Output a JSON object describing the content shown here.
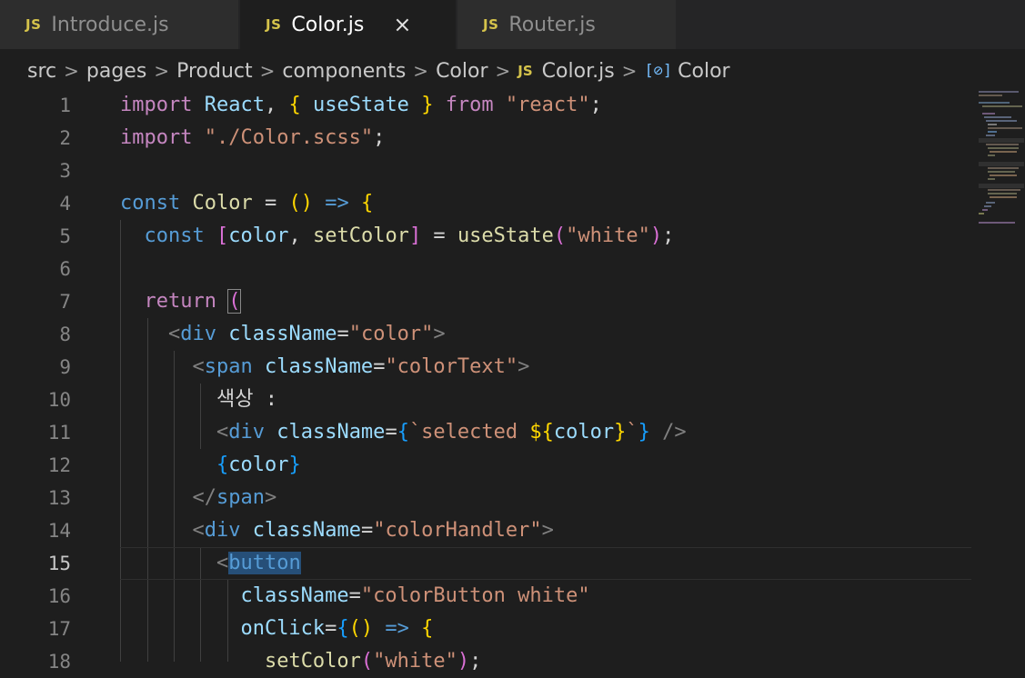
{
  "tabs": [
    {
      "icon": "JS",
      "label": "Introduce.js",
      "active": false
    },
    {
      "icon": "JS",
      "label": "Color.js",
      "active": true,
      "close": "×"
    },
    {
      "icon": "JS",
      "label": "Router.js",
      "active": false
    }
  ],
  "breadcrumb": {
    "items": [
      "src",
      "pages",
      "Product",
      "components",
      "Color"
    ],
    "file_icon": "JS",
    "file": "Color.js",
    "symbol_icon": "[⊘]",
    "symbol": "Color",
    "separator": ">"
  },
  "editor": {
    "current_line": 15,
    "line_numbers": [
      "1",
      "2",
      "3",
      "4",
      "5",
      "6",
      "7",
      "8",
      "9",
      "10",
      "11",
      "12",
      "13",
      "14",
      "15",
      "16",
      "17",
      "18"
    ],
    "tokens": {
      "import": "import",
      "from": "from",
      "react_name": "React",
      "useState": "useState",
      "react_str": "\"react\"",
      "scss_str": "\"./Color.scss\"",
      "const": "const",
      "Color": "Color",
      "arrow": "=>",
      "color": "color",
      "setColor": "setColor",
      "white_str": "\"white\"",
      "return": "return",
      "div": "div",
      "span": "span",
      "button": "button",
      "className": "className",
      "cls_color": "\"color\"",
      "cls_colorText": "\"colorText\"",
      "korean_label": "색상 :",
      "tpl_open": "`selected ",
      "tpl_close": "`",
      "cls_colorHandler": "\"colorHandler\"",
      "cls_colorButton": "\"colorButton white\"",
      "onClick": "onClick"
    }
  },
  "colors": {
    "keyword_purple": "#c586c0",
    "keyword_blue": "#569cd6",
    "variable": "#9cdcfe",
    "function": "#dcdcaa",
    "string": "#ce9178",
    "js_icon": "#d5c34b"
  }
}
